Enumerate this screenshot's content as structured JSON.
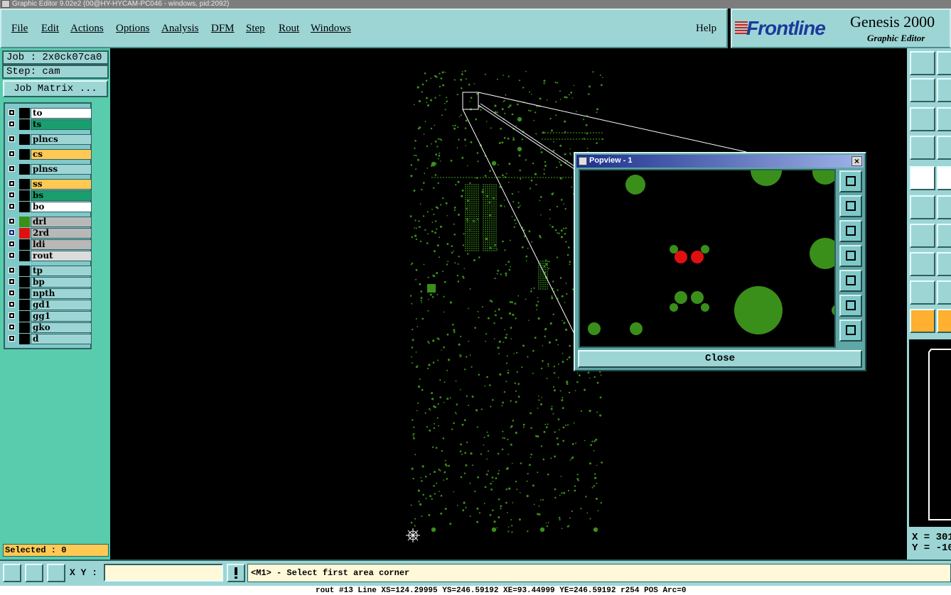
{
  "window": {
    "title": "Graphic Editor 9.02e2 (00@HY-HYCAM-PC046 - windows, pid:2092)"
  },
  "menu": {
    "items": [
      "File",
      "Edit",
      "Actions",
      "Options",
      "Analysis",
      "DFM",
      "Step",
      "Rout",
      "Windows"
    ],
    "help": "Help"
  },
  "brand": {
    "logo": "Frontline",
    "product": "Genesis 2000",
    "subtitle": "Graphic Editor"
  },
  "job": {
    "job_label": "Job : 2x0ck07ca0",
    "step_label": "Step: cam",
    "matrix_button": "Job Matrix ..."
  },
  "layers": [
    {
      "name": "to",
      "color": "#ffffff",
      "swatch": "#000000",
      "active": false
    },
    {
      "name": "ts",
      "color": "#1a9e6e",
      "swatch": "#000000",
      "active": false
    },
    {
      "name": "plncs",
      "color": "#9dd5d5",
      "swatch": "#000000",
      "active": false
    },
    {
      "name": "cs",
      "color": "#ffc954",
      "swatch": "#000000",
      "active": false
    },
    {
      "name": "plnss",
      "color": "#9dd5d5",
      "swatch": "#000000",
      "active": false
    },
    {
      "name": "ss",
      "color": "#ffc954",
      "swatch": "#000000",
      "active": false
    },
    {
      "name": "bs",
      "color": "#1a9e6e",
      "swatch": "#000000",
      "active": false
    },
    {
      "name": "bo",
      "color": "#ffffff",
      "swatch": "#000000",
      "active": false
    },
    {
      "name": "drl",
      "color": "#b8b8b8",
      "swatch": "#3a8f1a",
      "active": false
    },
    {
      "name": "2rd",
      "color": "#b8b8b8",
      "swatch": "#e01010",
      "active": true
    },
    {
      "name": "ldi",
      "color": "#b8b8b8",
      "swatch": "#000000",
      "active": false
    },
    {
      "name": "rout",
      "color": "#dcdcdc",
      "swatch": "#000000",
      "active": false
    },
    {
      "name": "tp",
      "color": "#9dd5d5",
      "swatch": "#000000",
      "active": false
    },
    {
      "name": "bp",
      "color": "#9dd5d5",
      "swatch": "#000000",
      "active": false
    },
    {
      "name": "npth",
      "color": "#9dd5d5",
      "swatch": "#000000",
      "active": false
    },
    {
      "name": "gd1",
      "color": "#9dd5d5",
      "swatch": "#000000",
      "active": false
    },
    {
      "name": "gg1",
      "color": "#9dd5d5",
      "swatch": "#000000",
      "active": false
    },
    {
      "name": "gko",
      "color": "#9dd5d5",
      "swatch": "#000000",
      "active": false
    },
    {
      "name": "d",
      "color": "#9dd5d5",
      "swatch": "#000000",
      "active": false
    }
  ],
  "status": {
    "selected": "Selected : 0",
    "xy_label": "X Y :",
    "xy_value": "",
    "prompt": "<M1> - Select first area corner",
    "info": "rout #13 Line XS=124.29995 YS=246.59192 XE=93.44999 YE=246.59192 r254 POS Arc=0"
  },
  "readout": {
    "x": "X = 301",
    "y": "Y = -10"
  },
  "popview": {
    "title": "Popview - 1",
    "close_button": "Close",
    "close_x": "×"
  },
  "colors": {
    "pad_green": "#3a8f1a",
    "pad_red": "#e01010",
    "panel": "#9dd5d5",
    "accent": "#58ccad"
  }
}
